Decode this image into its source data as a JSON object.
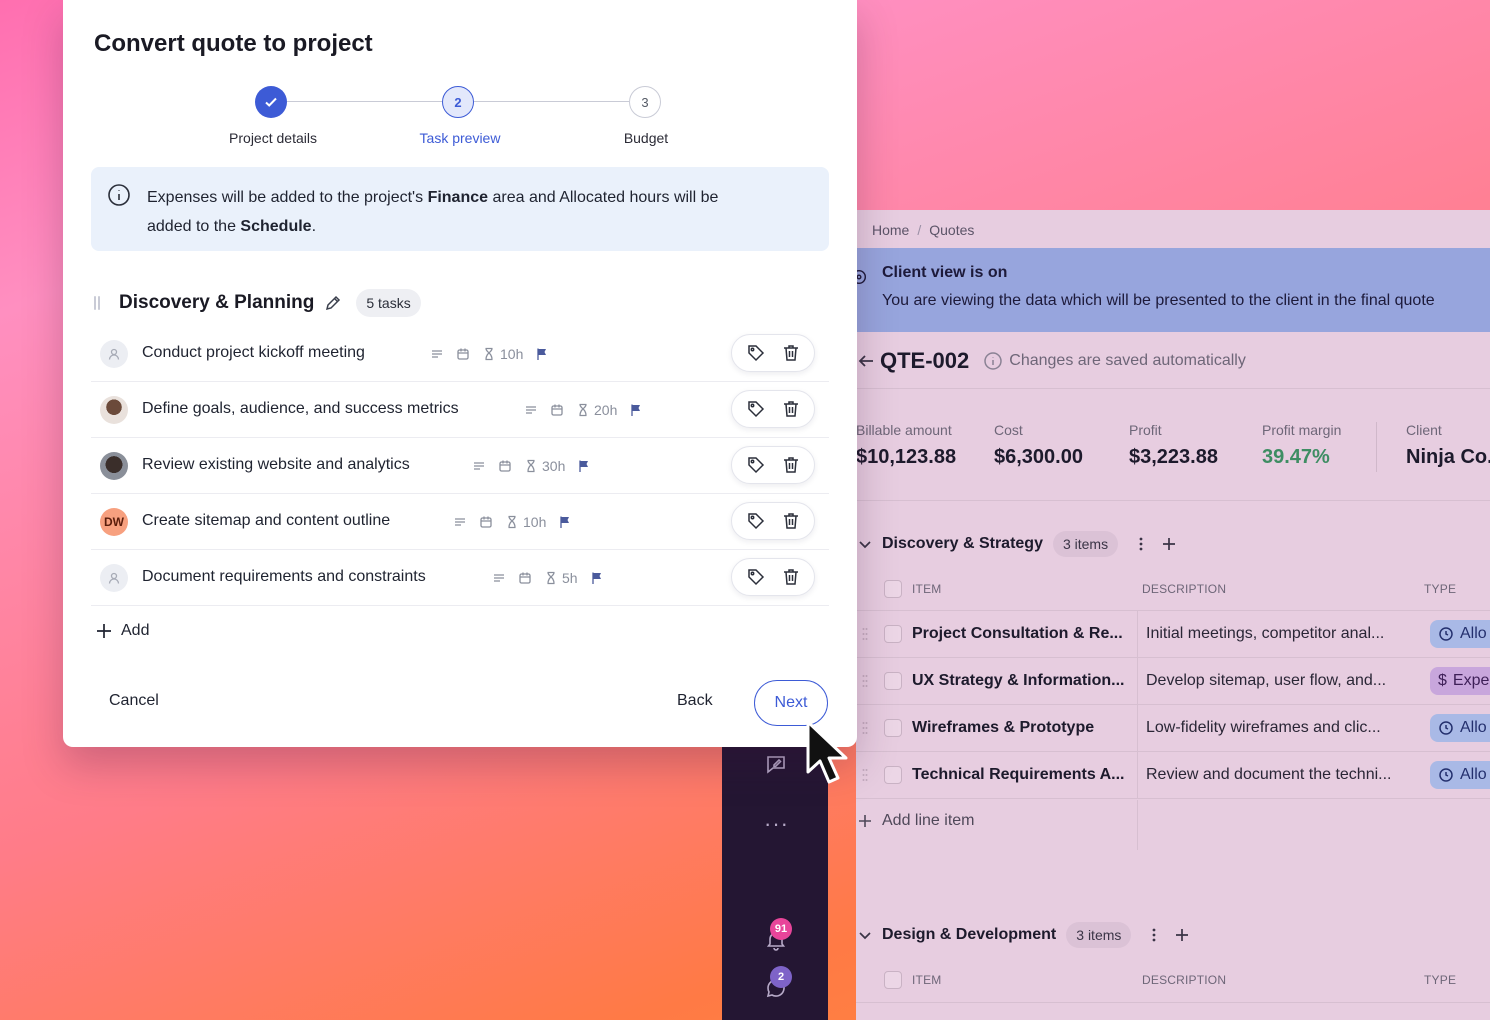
{
  "modal": {
    "title": "Convert quote to project",
    "steps": [
      {
        "number": "1",
        "label": "Project details",
        "state": "done"
      },
      {
        "number": "2",
        "label": "Task preview",
        "state": "active"
      },
      {
        "number": "3",
        "label": "Budget",
        "state": "todo"
      }
    ],
    "info": {
      "part1": "Expenses will be added to the project's ",
      "finance": "Finance",
      "part2": " area and Allocated hours will be",
      "part3": "added to the ",
      "schedule": "Schedule",
      "part4": "."
    },
    "group": {
      "title": "Discovery & Planning",
      "count": "5 tasks"
    },
    "tasks": [
      {
        "name": "Conduct project kickoff meeting",
        "hours": "10h",
        "avatar": "empty"
      },
      {
        "name": "Define goals, audience, and success metrics",
        "hours": "20h",
        "avatar": "photo"
      },
      {
        "name": "Review existing website and analytics",
        "hours": "30h",
        "avatar": "photo"
      },
      {
        "name": "Create sitemap and content outline",
        "hours": "10h",
        "avatar": "DW"
      },
      {
        "name": "Document requirements and constraints",
        "hours": "5h",
        "avatar": "empty"
      }
    ],
    "add_label": "Add",
    "cancel_label": "Cancel",
    "back_label": "Back",
    "next_label": "Next"
  },
  "sidebar": {
    "notifications_badge": "91",
    "messages_badge": "2"
  },
  "quote": {
    "breadcrumb": [
      "Home",
      "Quotes"
    ],
    "banner_title": "Client view is on",
    "banner_text": "You are viewing the data which will be presented to the client in the final quote",
    "id": "QTE-002",
    "saved_text": "Changes are saved automatically",
    "metrics": [
      {
        "label": "Billable amount",
        "value": "$10,123.88"
      },
      {
        "label": "Cost",
        "value": "$6,300.00"
      },
      {
        "label": "Profit",
        "value": "$3,223.88"
      },
      {
        "label": "Profit margin",
        "value": "39.47%"
      },
      {
        "label": "Client",
        "value": "Ninja Co."
      }
    ],
    "sections": [
      {
        "title": "Discovery & Strategy",
        "count": "3 items",
        "columns": [
          "ITEM",
          "DESCRIPTION",
          "TYPE"
        ],
        "rows": [
          {
            "item": "Project Consultation & Re...",
            "description": "Initial meetings, competitor anal...",
            "type": "Allo"
          },
          {
            "item": "UX Strategy & Information...",
            "description": "Develop sitemap, user flow, and...",
            "type": "Expe"
          },
          {
            "item": "Wireframes & Prototype",
            "description": "Low-fidelity wireframes and clic...",
            "type": "Allo"
          },
          {
            "item": "Technical Requirements A...",
            "description": "Review and document the techni...",
            "type": "Allo"
          }
        ],
        "add_line_label": "Add line item"
      },
      {
        "title": "Design & Development",
        "count": "3 items",
        "columns": [
          "ITEM",
          "DESCRIPTION",
          "TYPE"
        ]
      }
    ]
  },
  "colors": {
    "accent": "#3d5bd6",
    "profit_margin": "#3e8d63",
    "banner": "#97a5dd"
  }
}
